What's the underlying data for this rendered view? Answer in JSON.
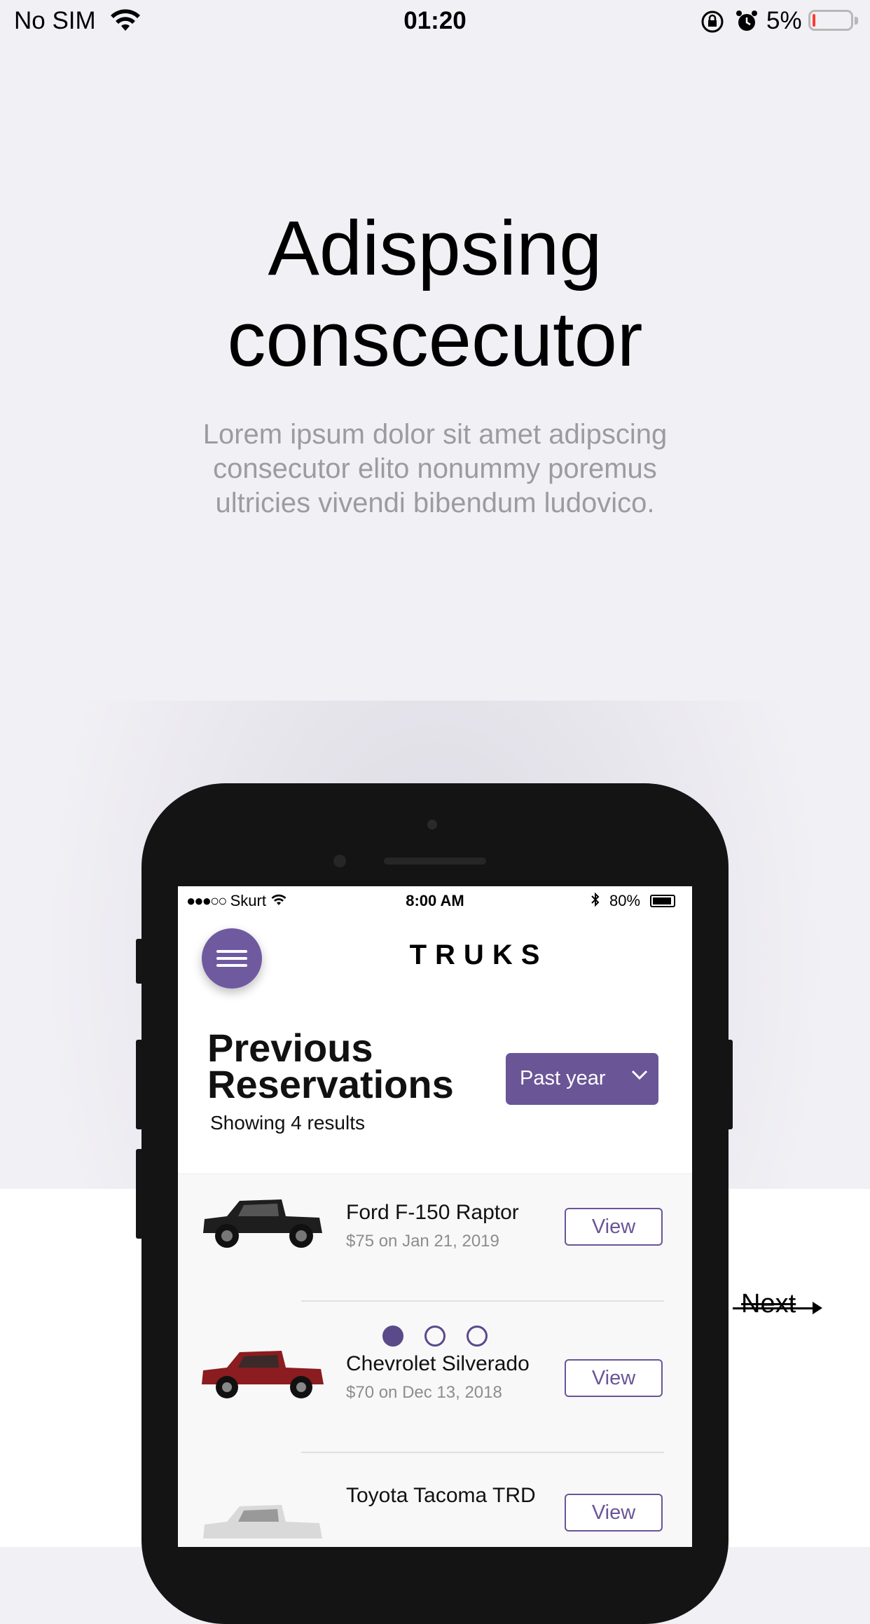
{
  "status_bar": {
    "carrier": "No SIM",
    "time": "01:20",
    "battery_percent": "5%"
  },
  "onboarding": {
    "headline_line1": "Adispsing",
    "headline_line2": "conscecutor",
    "subtitle_line1": "Lorem ipsum dolor sit amet adipscing",
    "subtitle_line2": "consecutor elito nonummy poremus",
    "subtitle_line3": "ultricies vivendi bibendum ludovico.",
    "page_indicator": {
      "count": 3,
      "active": 0
    },
    "next_label": "Next"
  },
  "mockup": {
    "status": {
      "carrier": "Skurt",
      "time": "8:00 AM",
      "battery": "80%"
    },
    "brand": "TRUKS",
    "title_line1": "Previous",
    "title_line2": "Reservations",
    "result_count": "Showing 4 results",
    "filter_label": "Past year",
    "reservations": [
      {
        "name": "Ford F-150 Raptor",
        "detail": "$75 on Jan 21, 2019",
        "action": "View",
        "color": "#1e1e1e"
      },
      {
        "name": "Chevrolet Silverado",
        "detail": "$70 on Dec 13, 2018",
        "action": "View",
        "color": "#8b1c1f"
      },
      {
        "name": "Toyota Tacoma TRD",
        "detail": "",
        "action": "View",
        "color": "#d9d9d9"
      }
    ]
  },
  "colors": {
    "accent": "#6a5597",
    "background": "#f1f0f5"
  }
}
